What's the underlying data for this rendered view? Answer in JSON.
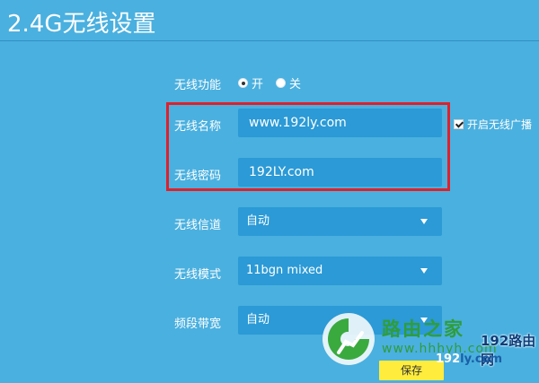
{
  "page": {
    "title": "2.4G无线设置"
  },
  "wireless_function": {
    "label": "无线功能",
    "options": [
      {
        "label": "开",
        "checked": true
      },
      {
        "label": "关",
        "checked": false
      }
    ]
  },
  "ssid": {
    "label": "无线名称",
    "value": "www.192ly.com"
  },
  "broadcast": {
    "label": "开启无线广播",
    "checked": true
  },
  "password": {
    "label": "无线密码",
    "value": "192LY.com"
  },
  "channel": {
    "label": "无线信道",
    "value": "自动"
  },
  "mode": {
    "label": "无线模式",
    "value": "11bgn mixed"
  },
  "bandwidth": {
    "label": "频段带宽",
    "value": "自动"
  },
  "actions": {
    "save_label": "保存"
  },
  "watermark": {
    "name": "路由之家",
    "url": "www.hhhyh.com",
    "brand": "192路由网",
    "brand_url_a": "192",
    "brand_url_b": "ly.com"
  },
  "colors": {
    "background": "#4ab0df",
    "field": "#2b9ad6",
    "highlight": "#e0202a",
    "save_button": "#ffec3d",
    "watermark_green": "#2f9d3a"
  }
}
